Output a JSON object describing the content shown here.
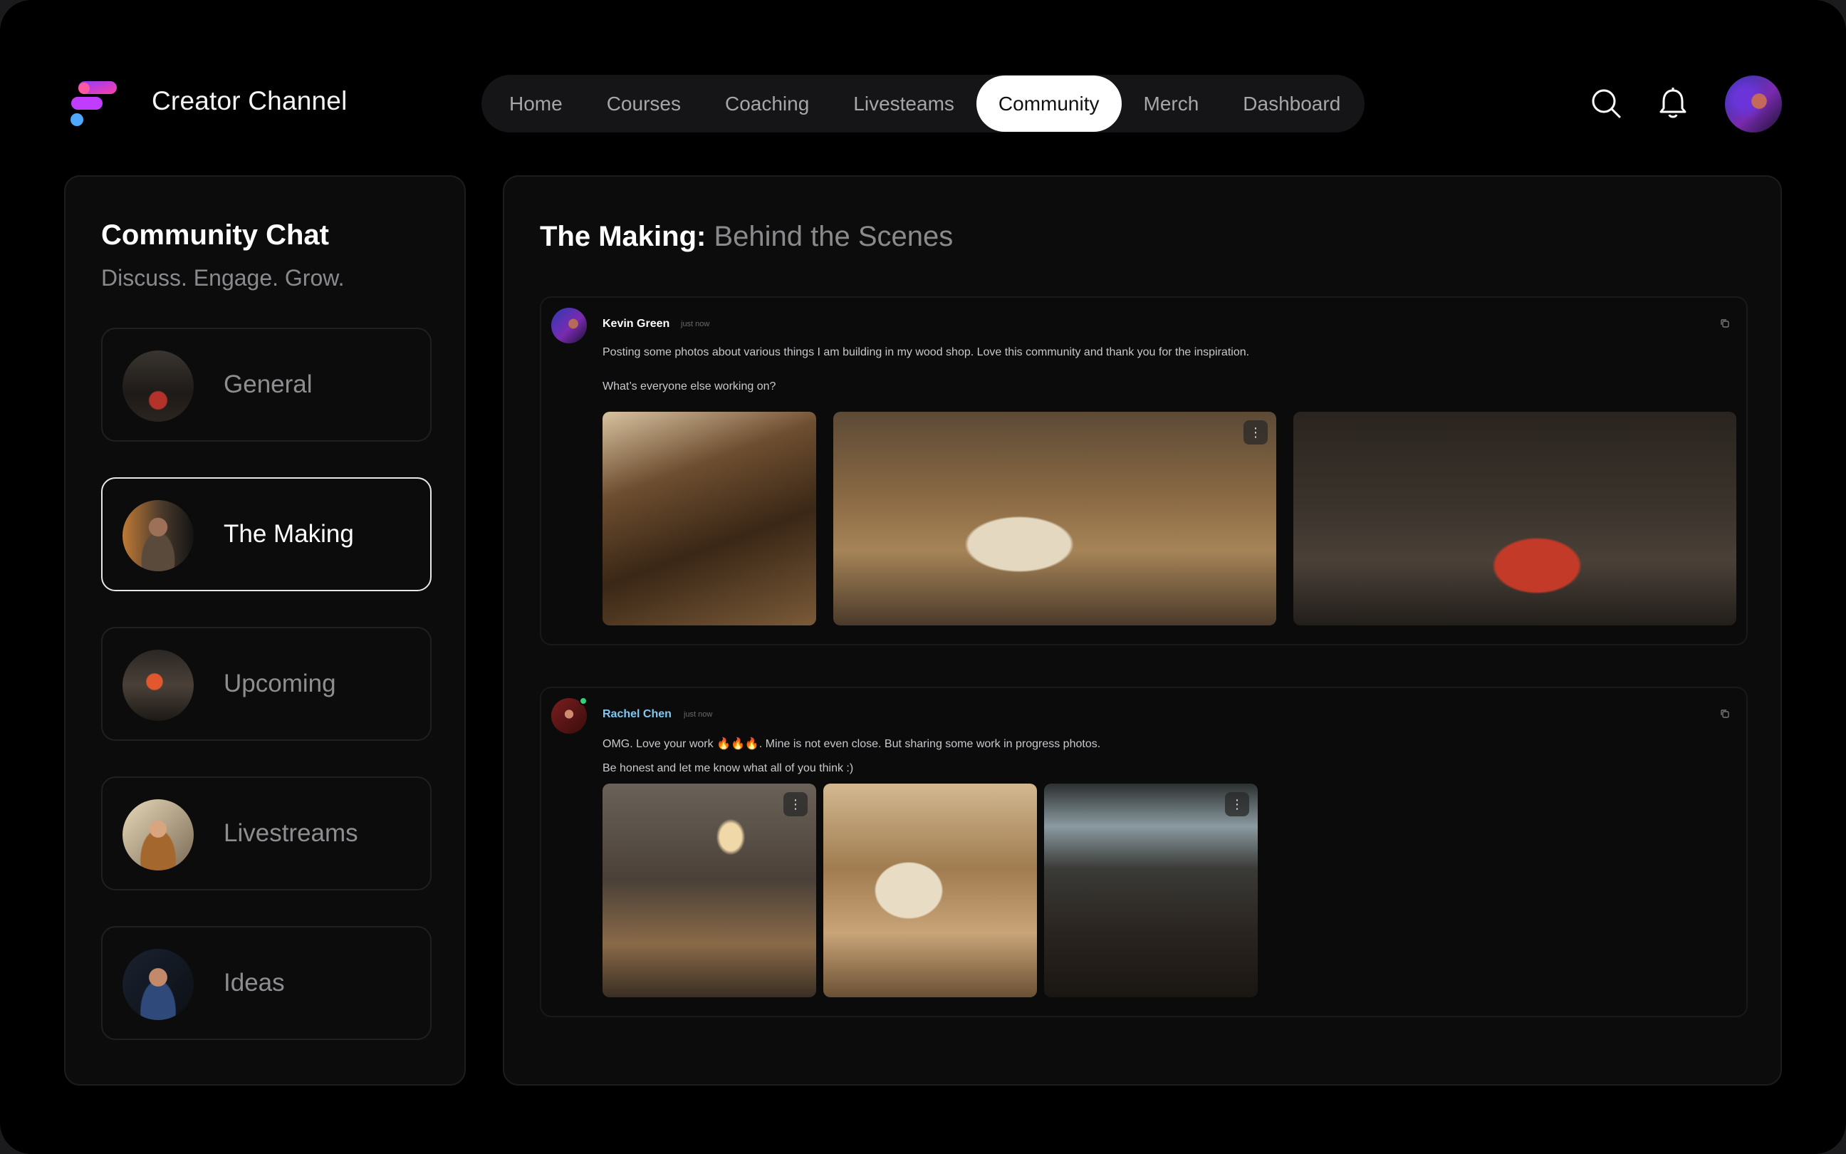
{
  "app": {
    "title": "Creator Channel"
  },
  "nav": {
    "items": [
      {
        "label": "Home",
        "active": false
      },
      {
        "label": "Courses",
        "active": false
      },
      {
        "label": "Coaching",
        "active": false
      },
      {
        "label": "Livesteams",
        "active": false
      },
      {
        "label": "Community",
        "active": true
      },
      {
        "label": "Merch",
        "active": false
      },
      {
        "label": "Dashboard",
        "active": false
      }
    ]
  },
  "header_icons": [
    "search-icon",
    "bell-icon"
  ],
  "sidebar": {
    "title": "Community Chat",
    "subtitle": "Discuss. Engage. Grow.",
    "channels": [
      {
        "label": "General",
        "active": false
      },
      {
        "label": "The Making",
        "active": true
      },
      {
        "label": "Upcoming",
        "active": false
      },
      {
        "label": "Livestreams",
        "active": false
      },
      {
        "label": "Ideas",
        "active": false
      }
    ]
  },
  "main": {
    "title_strong": "The Making:",
    "title_light": "Behind the Scenes",
    "posts": [
      {
        "author": "Kevin Green",
        "time": "just now",
        "line1": "Posting some photos about various things I am building in my wood shop. Love this community and thank you for the inspiration.",
        "line2": "What’s everyone else working on?"
      },
      {
        "author": "Rachel Chen",
        "time": "just now",
        "line1": "OMG. Love your work 🔥🔥🔥. Mine is not even close. But sharing some work in progress photos.",
        "line2": "Be honest and let me know what all of you think :)"
      }
    ]
  },
  "colors": {
    "background": "#000000",
    "panel": "#0c0c0d",
    "accent_blue": "#7fc8f0",
    "online": "#33d17a"
  }
}
